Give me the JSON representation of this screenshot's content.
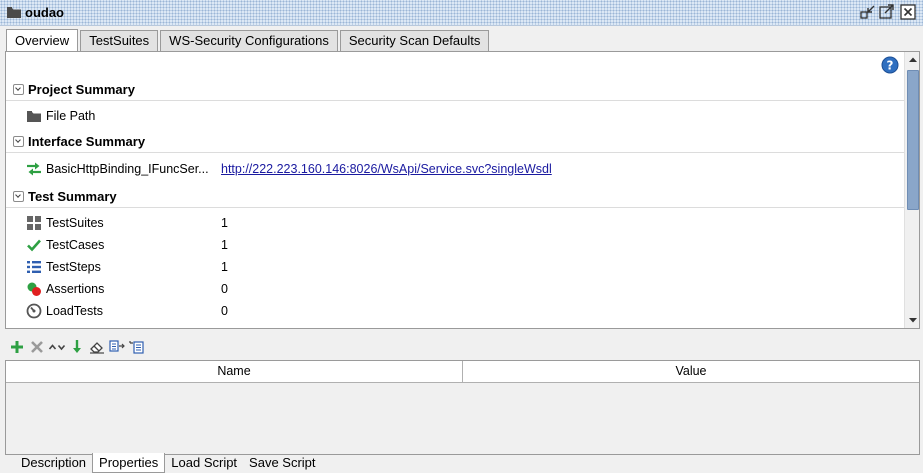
{
  "window": {
    "title": "oudao"
  },
  "tabs": [
    {
      "label": "Overview",
      "active": true
    },
    {
      "label": "TestSuites",
      "active": false
    },
    {
      "label": "WS-Security Configurations",
      "active": false
    },
    {
      "label": "Security Scan Defaults",
      "active": false
    }
  ],
  "overview": {
    "project_summary": {
      "label": "Project Summary",
      "rows": [
        {
          "name": "File Path",
          "icon": "folder-icon"
        }
      ]
    },
    "interface_summary": {
      "label": "Interface Summary",
      "rows": [
        {
          "name": "BasicHttpBinding_IFuncSer...",
          "link": "http://222.223.160.146:8026/WsApi/Service.svc?singleWsdl",
          "icon": "interface-icon"
        }
      ]
    },
    "test_summary": {
      "label": "Test Summary",
      "rows": [
        {
          "name": "TestSuites",
          "value": "1",
          "icon": "testsuite-icon"
        },
        {
          "name": "TestCases",
          "value": "1",
          "icon": "checkmark-icon"
        },
        {
          "name": "TestSteps",
          "value": "1",
          "icon": "teststeps-icon"
        },
        {
          "name": "Assertions",
          "value": "0",
          "icon": "assertion-icon"
        },
        {
          "name": "LoadTests",
          "value": "0",
          "icon": "gauge-icon"
        }
      ]
    }
  },
  "properties_table": {
    "columns": [
      "Name",
      "Value"
    ]
  },
  "bottom_tabs": [
    {
      "label": "Description",
      "active": false
    },
    {
      "label": "Properties",
      "active": true
    },
    {
      "label": "Load Script",
      "active": false
    },
    {
      "label": "Save Script",
      "active": false
    }
  ],
  "colors": {
    "accent_green": "#2ea043",
    "link_blue": "#1a1aa0",
    "scroll_thumb": "#8aa6c9"
  }
}
